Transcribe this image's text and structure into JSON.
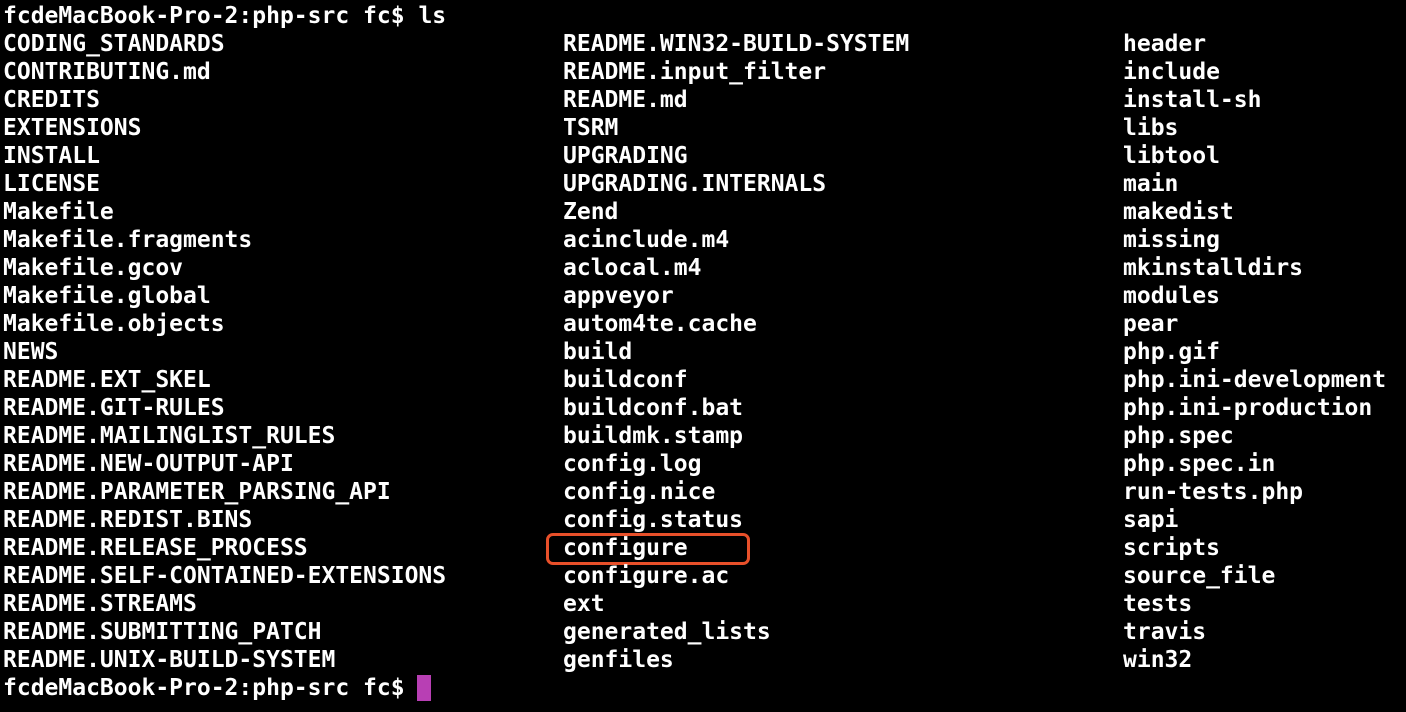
{
  "terminal": {
    "prompt": "fcdeMacBook-Pro-2:php-src fc$",
    "command": "ls",
    "highlighted_entry": "configure",
    "highlight_color": "#e8502a",
    "cursor_color": "#b83fb4",
    "background_color": "#000000",
    "text_color": "#ffffff"
  },
  "listing": {
    "columns": [
      [
        "CODING_STANDARDS",
        "CONTRIBUTING.md",
        "CREDITS",
        "EXTENSIONS",
        "INSTALL",
        "LICENSE",
        "Makefile",
        "Makefile.fragments",
        "Makefile.gcov",
        "Makefile.global",
        "Makefile.objects",
        "NEWS",
        "README.EXT_SKEL",
        "README.GIT-RULES",
        "README.MAILINGLIST_RULES",
        "README.NEW-OUTPUT-API",
        "README.PARAMETER_PARSING_API",
        "README.REDIST.BINS",
        "README.RELEASE_PROCESS",
        "README.SELF-CONTAINED-EXTENSIONS",
        "README.STREAMS",
        "README.SUBMITTING_PATCH",
        "README.UNIX-BUILD-SYSTEM"
      ],
      [
        "README.WIN32-BUILD-SYSTEM",
        "README.input_filter",
        "README.md",
        "TSRM",
        "UPGRADING",
        "UPGRADING.INTERNALS",
        "Zend",
        "acinclude.m4",
        "aclocal.m4",
        "appveyor",
        "autom4te.cache",
        "build",
        "buildconf",
        "buildconf.bat",
        "buildmk.stamp",
        "config.log",
        "config.nice",
        "config.status",
        "configure",
        "configure.ac",
        "ext",
        "generated_lists",
        "genfiles"
      ],
      [
        "header",
        "include",
        "install-sh",
        "libs",
        "libtool",
        "main",
        "makedist",
        "missing",
        "mkinstalldirs",
        "modules",
        "pear",
        "php.gif",
        "php.ini-development",
        "php.ini-production",
        "php.spec",
        "php.spec.in",
        "run-tests.php",
        "sapi",
        "scripts",
        "source_file",
        "tests",
        "travis",
        "win32"
      ]
    ]
  }
}
